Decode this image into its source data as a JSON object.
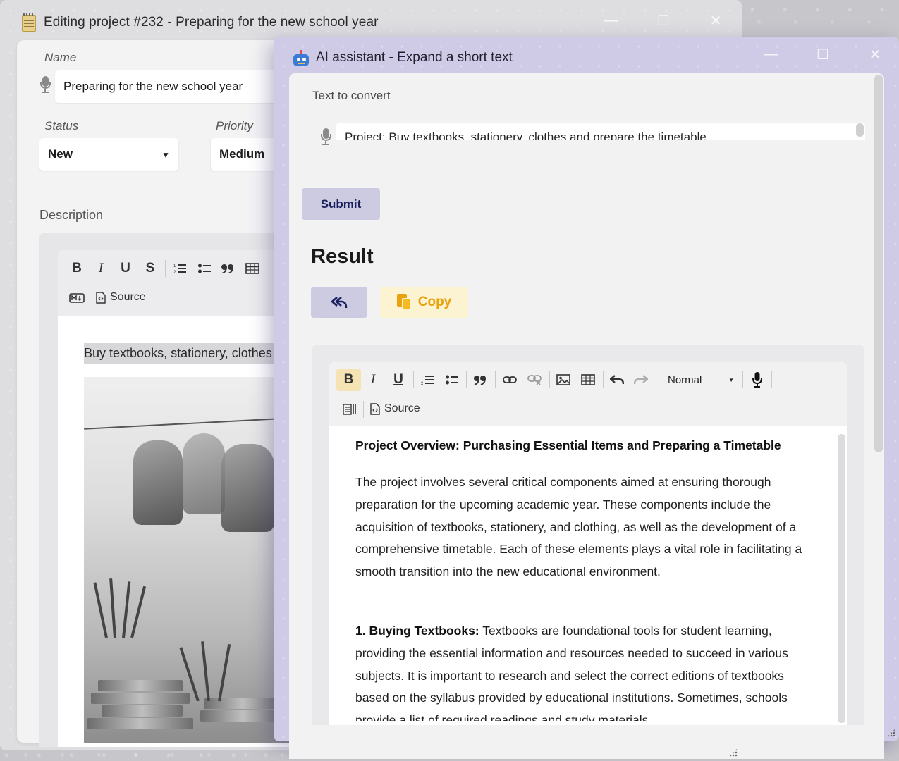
{
  "back_window": {
    "title": "Editing project #232 - Preparing for the new school year",
    "controls": {
      "minimize": "—",
      "maximize": "☐",
      "close": "✕"
    },
    "name_label": "Name",
    "name_value": "Preparing for the new school year",
    "status_label": "Status",
    "status_value": "New",
    "priority_label": "Priority",
    "priority_value": "Medium",
    "description_label": "Description",
    "toolbar": {
      "bold": "B",
      "italic": "I",
      "underline": "U",
      "strike": "S",
      "source_label": "Source"
    },
    "description_text": "Buy textbooks, stationery, clothes and prepare the timetable"
  },
  "ai_window": {
    "title": "AI assistant - Expand a short text",
    "controls": {
      "minimize": "—",
      "maximize": "☐",
      "close": "✕"
    },
    "input_label": "Text to convert",
    "input_value": "Project: Buy textbooks, stationery, clothes and prepare the timetable",
    "submit_label": "Submit",
    "result_heading": "Result",
    "copy_label": "Copy",
    "toolbar": {
      "bold": "B",
      "italic": "I",
      "underline": "U",
      "format_value": "Normal",
      "source_label": "Source"
    },
    "result": {
      "heading": "Project Overview: Purchasing Essential Items and Preparing a Timetable",
      "paragraph1": "The project involves several critical components aimed at ensuring thorough preparation for the upcoming academic year. These components include the acquisition of textbooks, stationery, and clothing, as well as the development of a comprehensive timetable. Each of these elements plays a vital role in facilitating a smooth transition into the new educational environment.",
      "item1_title": "1. Buying Textbooks:",
      "item1_text": " Textbooks are foundational tools for student learning, providing the essential information and resources needed to succeed in various subjects. It is important to research and select the correct editions of textbooks based on the syllabus provided by educational institutions. Sometimes, schools provide a list of required readings and study materials"
    }
  },
  "colors": {
    "ai_window_bg": "#cfcbe6",
    "submit_bg": "#cdcbe2",
    "submit_text": "#1a1f5e",
    "copy_bg": "#fcf3d2",
    "copy_text": "#e8a20d"
  }
}
